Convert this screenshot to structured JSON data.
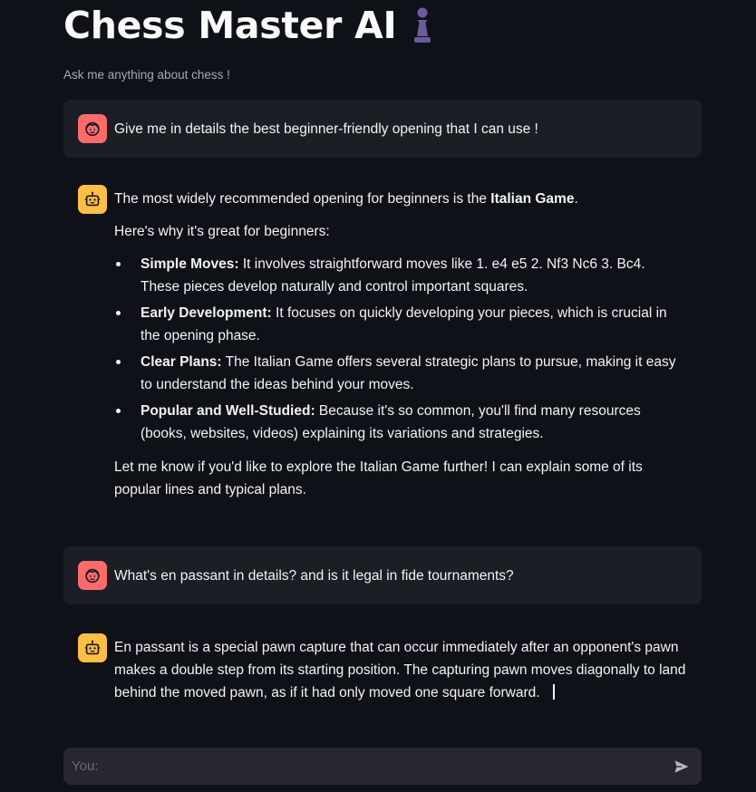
{
  "header": {
    "title": "Chess Master AI",
    "icon": "chess-pawn-icon",
    "subtitle": "Ask me anything about chess !"
  },
  "colors": {
    "background": "#0e1117",
    "user_bubble": "#1c1e25",
    "user_avatar": "#ff6b6b",
    "bot_avatar": "#ffbe45",
    "input_bg": "#262730",
    "pawn": "#6b5b9a"
  },
  "messages": [
    {
      "role": "user",
      "avatar_icon": "user-face-icon",
      "text": "Give me in details the best beginner-friendly opening that I can use !"
    },
    {
      "role": "assistant",
      "avatar_icon": "robot-icon",
      "intro_prefix": "The most widely recommended opening for beginners is the ",
      "intro_bold": "Italian Game",
      "intro_suffix": ".",
      "why": "Here's why it's great for beginners:",
      "points": [
        {
          "title": "Simple Moves:",
          "text": " It involves straightforward moves like 1. e4 e5 2. Nf3 Nc6 3. Bc4. These pieces develop naturally and control important squares."
        },
        {
          "title": "Early Development:",
          "text": " It focuses on quickly developing your pieces, which is crucial in the opening phase."
        },
        {
          "title": "Clear Plans:",
          "text": " The Italian Game offers several strategic plans to pursue, making it easy to understand the ideas behind your moves."
        },
        {
          "title": "Popular and Well-Studied:",
          "text": " Because it's so common, you'll find many resources (books, websites, videos) explaining its variations and strategies."
        }
      ],
      "outro": "Let me know if you'd like to explore the Italian Game further! I can explain some of its popular lines and typical plans."
    },
    {
      "role": "user",
      "avatar_icon": "user-face-icon",
      "text": "What's en passant in details? and is it legal in fide tournaments?"
    },
    {
      "role": "assistant",
      "avatar_icon": "robot-icon",
      "text": "En passant is a special pawn capture that can occur immediately after an opponent's pawn makes a double step from its starting position. The capturing pawn moves diagonally to land behind the moved pawn, as if it had only moved one square forward."
    }
  ],
  "chat_input": {
    "placeholder": "You:",
    "value": "",
    "send_icon": "send-icon"
  }
}
